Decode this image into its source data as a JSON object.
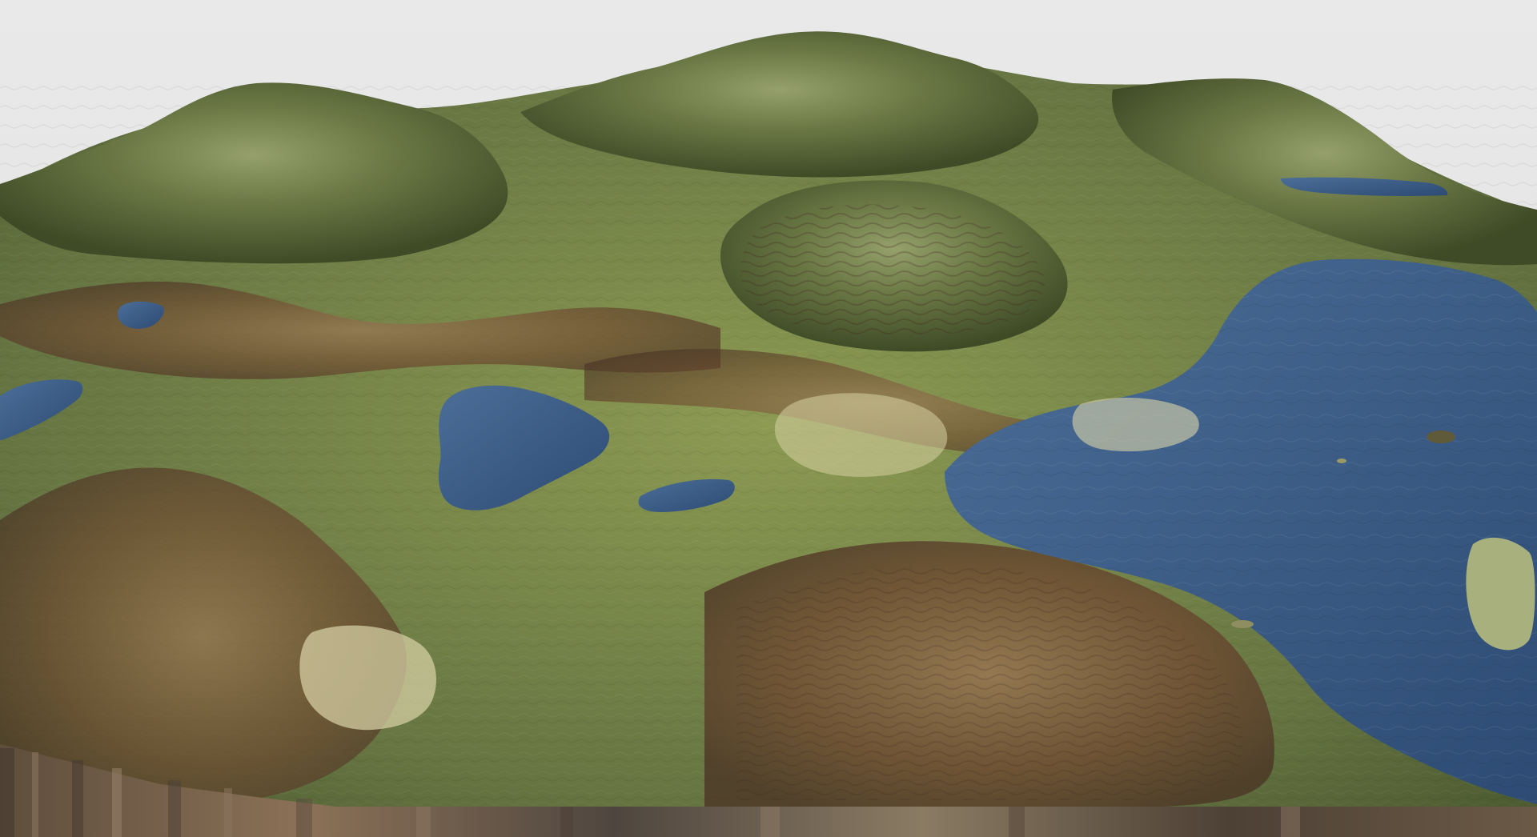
{
  "scene": {
    "subject": "terrain-render",
    "colors": {
      "sky": "#e5e5e5",
      "grass": "#6f7a3f",
      "dark_grass": "#4e5c2d",
      "rock_brown": "#7a5638",
      "sand": "#d9d2a8",
      "water": "#3c5f8c",
      "water_deep": "#2f4f79",
      "edge": "#6b5a46"
    }
  }
}
